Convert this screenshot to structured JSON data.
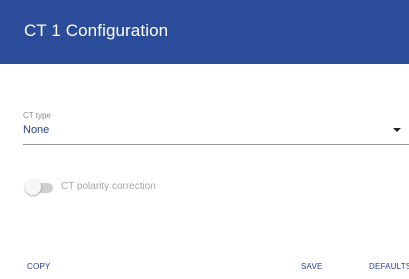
{
  "header": {
    "title": "CT 1 Configuration"
  },
  "ct_type": {
    "label": "CT type",
    "value": "None"
  },
  "polarity_toggle": {
    "label": "CT polarity correction",
    "enabled": false
  },
  "actions": {
    "copy_label": "COPY",
    "save_label": "SAVE",
    "defaults_label": "DEFAULTS"
  },
  "colors": {
    "header_background": "#2b4c9a",
    "accent_text": "#2a3f8f"
  }
}
